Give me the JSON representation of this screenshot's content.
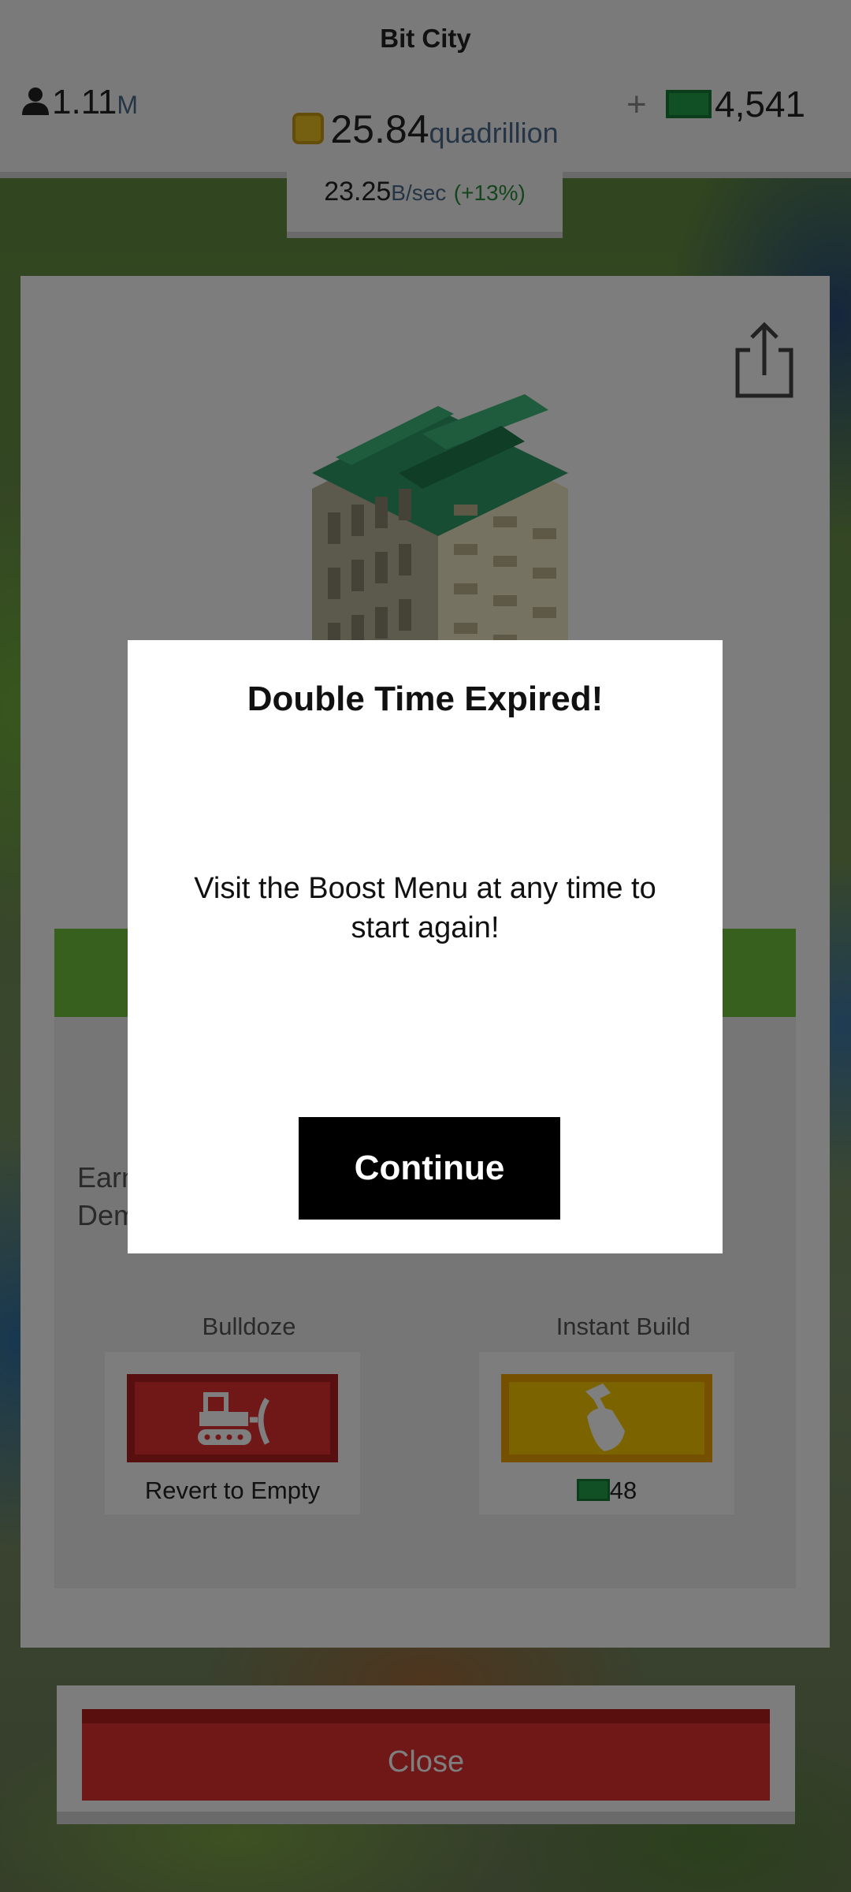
{
  "hud": {
    "city_name": "Bit City",
    "population_value": "1.11",
    "population_unit": "M",
    "coins_value": "25.84",
    "coins_unit": "quadrillion",
    "cash_plus": "+",
    "cash_value": "4,541",
    "rate_value": "23.25",
    "rate_unit": "B/sec",
    "rate_boost": "(+13%)"
  },
  "panel": {
    "earn_line1": "Earn",
    "earn_line2": "Dem",
    "bulldoze_label": "Bulldoze",
    "bulldoze_sub": "Revert to Empty",
    "instant_label": "Instant Build",
    "instant_cost": "48",
    "close_label": "Close"
  },
  "modal": {
    "title": "Double Time Expired!",
    "body": "Visit the Boost Menu at any time to start again!",
    "continue_label": "Continue"
  },
  "icons": [
    "person-icon",
    "coin-icon",
    "cash-icon",
    "share-icon",
    "bulldozer-icon",
    "hammer-icon"
  ],
  "colors": {
    "close_red": "#e02f2f",
    "bulldoze_red": "#e03030",
    "instant_yellow": "#f6c800",
    "panel_green": "#6fbf3a",
    "cash_green": "#22a04a",
    "coin_gold": "#e8c020"
  }
}
